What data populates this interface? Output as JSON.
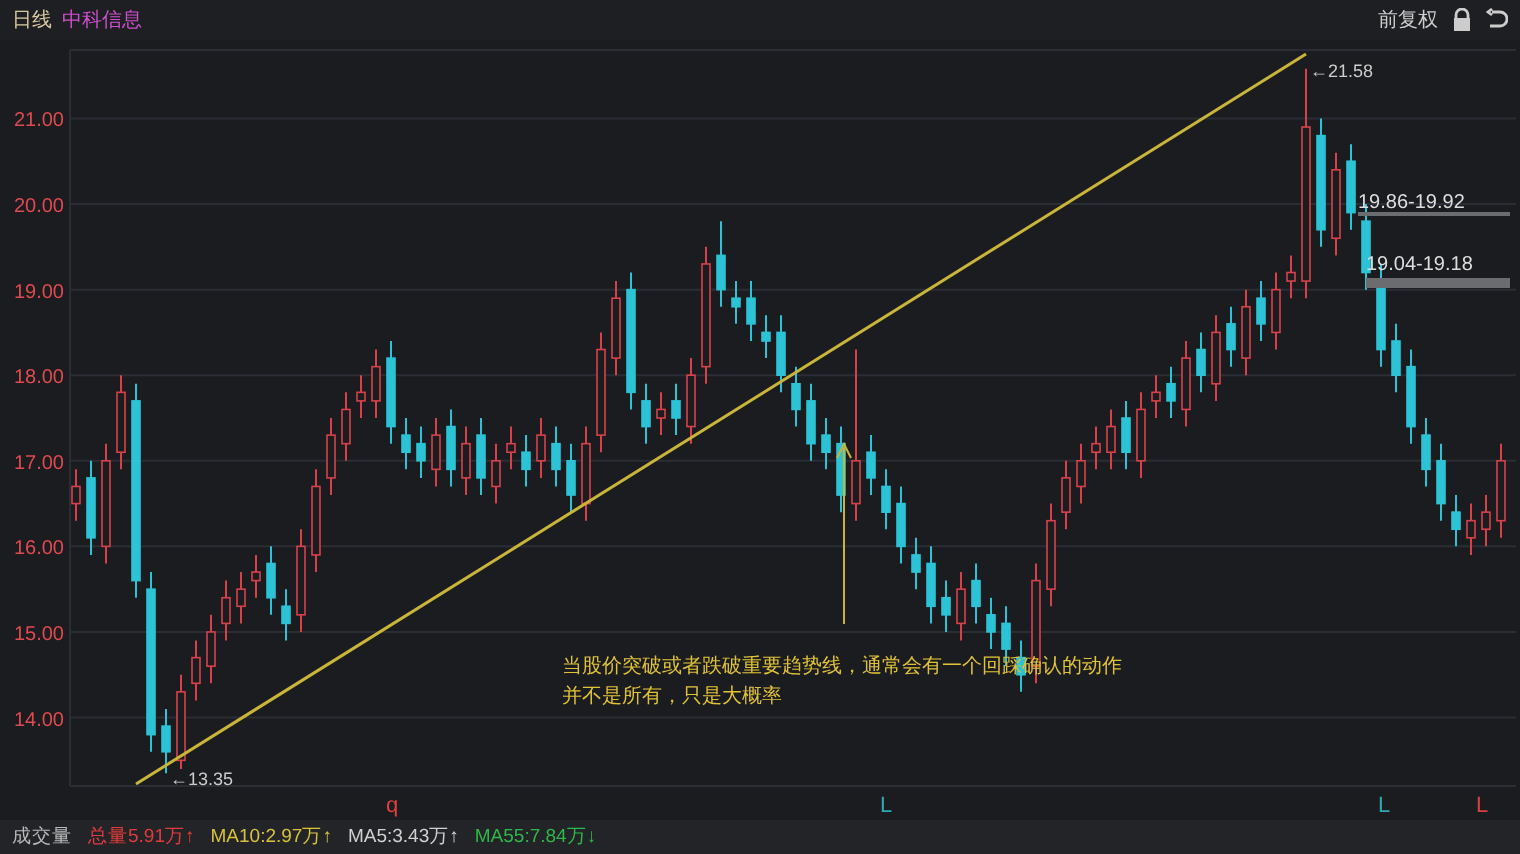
{
  "header": {
    "period": "日线",
    "name": "中科信息",
    "adjust": "前复权"
  },
  "chart_data": {
    "type": "candlestick",
    "ylim": [
      13.2,
      21.8
    ],
    "grid": true,
    "yticks": [
      {
        "value": 21,
        "label": "21.00"
      },
      {
        "value": 20,
        "label": "20.00"
      },
      {
        "value": 19,
        "label": "19.00"
      },
      {
        "value": 18,
        "label": "18.00"
      },
      {
        "value": 17,
        "label": "17.00"
      },
      {
        "value": 16,
        "label": "16.00"
      },
      {
        "value": 15,
        "label": "15.00"
      },
      {
        "value": 14,
        "label": "14.00"
      }
    ],
    "ohlc": [
      [
        16.5,
        16.9,
        16.3,
        16.7
      ],
      [
        16.8,
        17.0,
        15.9,
        16.1
      ],
      [
        16.0,
        17.2,
        15.8,
        17.0
      ],
      [
        17.1,
        18.0,
        16.9,
        17.8
      ],
      [
        17.7,
        17.9,
        15.4,
        15.6
      ],
      [
        15.5,
        15.7,
        13.6,
        13.8
      ],
      [
        13.9,
        14.1,
        13.35,
        13.6
      ],
      [
        13.5,
        14.5,
        13.4,
        14.3
      ],
      [
        14.4,
        14.9,
        14.2,
        14.7
      ],
      [
        14.6,
        15.2,
        14.4,
        15.0
      ],
      [
        15.1,
        15.6,
        14.9,
        15.4
      ],
      [
        15.3,
        15.7,
        15.1,
        15.5
      ],
      [
        15.6,
        15.9,
        15.4,
        15.7
      ],
      [
        15.8,
        16.0,
        15.2,
        15.4
      ],
      [
        15.3,
        15.5,
        14.9,
        15.1
      ],
      [
        15.2,
        16.2,
        15.0,
        16.0
      ],
      [
        15.9,
        16.9,
        15.7,
        16.7
      ],
      [
        16.8,
        17.5,
        16.6,
        17.3
      ],
      [
        17.2,
        17.8,
        17.0,
        17.6
      ],
      [
        17.7,
        18.0,
        17.5,
        17.8
      ],
      [
        17.7,
        18.3,
        17.5,
        18.1
      ],
      [
        18.2,
        18.4,
        17.2,
        17.4
      ],
      [
        17.3,
        17.5,
        16.9,
        17.1
      ],
      [
        17.2,
        17.4,
        16.8,
        17.0
      ],
      [
        16.9,
        17.5,
        16.7,
        17.3
      ],
      [
        17.4,
        17.6,
        16.7,
        16.9
      ],
      [
        16.8,
        17.4,
        16.6,
        17.2
      ],
      [
        17.3,
        17.5,
        16.6,
        16.8
      ],
      [
        16.7,
        17.2,
        16.5,
        17.0
      ],
      [
        17.1,
        17.4,
        16.9,
        17.2
      ],
      [
        17.1,
        17.3,
        16.7,
        16.9
      ],
      [
        17.0,
        17.5,
        16.8,
        17.3
      ],
      [
        17.2,
        17.4,
        16.7,
        16.9
      ],
      [
        17.0,
        17.2,
        16.4,
        16.6
      ],
      [
        16.5,
        17.4,
        16.3,
        17.2
      ],
      [
        17.3,
        18.5,
        17.1,
        18.3
      ],
      [
        18.2,
        19.1,
        18.0,
        18.9
      ],
      [
        19.0,
        19.2,
        17.6,
        17.8
      ],
      [
        17.7,
        17.9,
        17.2,
        17.4
      ],
      [
        17.5,
        17.8,
        17.3,
        17.6
      ],
      [
        17.7,
        17.9,
        17.3,
        17.5
      ],
      [
        17.4,
        18.2,
        17.2,
        18.0
      ],
      [
        18.1,
        19.5,
        17.9,
        19.3
      ],
      [
        19.4,
        19.8,
        18.8,
        19.0
      ],
      [
        18.9,
        19.1,
        18.6,
        18.8
      ],
      [
        18.9,
        19.1,
        18.4,
        18.6
      ],
      [
        18.5,
        18.7,
        18.2,
        18.4
      ],
      [
        18.5,
        18.7,
        17.8,
        18.0
      ],
      [
        17.9,
        18.1,
        17.4,
        17.6
      ],
      [
        17.7,
        17.9,
        17.0,
        17.2
      ],
      [
        17.3,
        17.5,
        16.9,
        17.1
      ],
      [
        17.2,
        17.4,
        16.4,
        16.6
      ],
      [
        16.5,
        18.3,
        16.3,
        17.0
      ],
      [
        17.1,
        17.3,
        16.6,
        16.8
      ],
      [
        16.7,
        16.9,
        16.2,
        16.4
      ],
      [
        16.5,
        16.7,
        15.8,
        16.0
      ],
      [
        15.9,
        16.1,
        15.5,
        15.7
      ],
      [
        15.8,
        16.0,
        15.1,
        15.3
      ],
      [
        15.4,
        15.6,
        15.0,
        15.2
      ],
      [
        15.1,
        15.7,
        14.9,
        15.5
      ],
      [
        15.6,
        15.8,
        15.1,
        15.3
      ],
      [
        15.2,
        15.4,
        14.8,
        15.0
      ],
      [
        15.1,
        15.3,
        14.6,
        14.8
      ],
      [
        14.7,
        14.9,
        14.3,
        14.5
      ],
      [
        14.6,
        15.8,
        14.4,
        15.6
      ],
      [
        15.5,
        16.5,
        15.3,
        16.3
      ],
      [
        16.4,
        17.0,
        16.2,
        16.8
      ],
      [
        16.7,
        17.2,
        16.5,
        17.0
      ],
      [
        17.1,
        17.4,
        16.9,
        17.2
      ],
      [
        17.1,
        17.6,
        16.9,
        17.4
      ],
      [
        17.5,
        17.7,
        16.9,
        17.1
      ],
      [
        17.0,
        17.8,
        16.8,
        17.6
      ],
      [
        17.7,
        18.0,
        17.5,
        17.8
      ],
      [
        17.9,
        18.1,
        17.5,
        17.7
      ],
      [
        17.6,
        18.4,
        17.4,
        18.2
      ],
      [
        18.3,
        18.5,
        17.8,
        18.0
      ],
      [
        17.9,
        18.7,
        17.7,
        18.5
      ],
      [
        18.6,
        18.8,
        18.1,
        18.3
      ],
      [
        18.2,
        19.0,
        18.0,
        18.8
      ],
      [
        18.9,
        19.1,
        18.4,
        18.6
      ],
      [
        18.5,
        19.2,
        18.3,
        19.0
      ],
      [
        19.1,
        19.4,
        18.9,
        19.2
      ],
      [
        19.1,
        21.58,
        18.9,
        20.9
      ],
      [
        20.8,
        21.0,
        19.5,
        19.7
      ],
      [
        19.6,
        20.6,
        19.4,
        20.4
      ],
      [
        20.5,
        20.7,
        19.7,
        19.9
      ],
      [
        19.8,
        20.0,
        19.0,
        19.2
      ],
      [
        19.1,
        19.3,
        18.1,
        18.3
      ],
      [
        18.4,
        18.6,
        17.8,
        18.0
      ],
      [
        18.1,
        18.3,
        17.2,
        17.4
      ],
      [
        17.3,
        17.5,
        16.7,
        16.9
      ],
      [
        17.0,
        17.2,
        16.3,
        16.5
      ],
      [
        16.4,
        16.6,
        16.0,
        16.2
      ],
      [
        16.1,
        16.5,
        15.9,
        16.3
      ],
      [
        16.2,
        16.6,
        16.0,
        16.4
      ],
      [
        16.3,
        17.2,
        16.1,
        17.0
      ]
    ]
  },
  "price_marks": [
    {
      "kind": "high",
      "text": "←21.58"
    },
    {
      "kind": "low",
      "text": "←13.35"
    }
  ],
  "zones": [
    {
      "text": "19.86-19.92"
    },
    {
      "text": "19.04-19.18"
    }
  ],
  "annotation": {
    "lines": [
      "当股价突破或者跌破重要趋势线，通常会有一个回踩确认的动作",
      "并不是所有，只是大概率"
    ]
  },
  "signals": [
    {
      "text": "q",
      "color": "#e0403f"
    },
    {
      "text": "L",
      "color": "#2fa8b5"
    },
    {
      "text": "L",
      "color": "#2fa8b5"
    },
    {
      "text": "L",
      "color": "#d84040"
    }
  ],
  "volume_bar": {
    "label": "成交量",
    "items": [
      {
        "text": "总量5.91万↑",
        "color": "#e03b3b"
      },
      {
        "text": "MA10:2.97万↑",
        "color": "#d8c23a"
      },
      {
        "text": "MA5:3.43万↑",
        "color": "#d0d0d0"
      },
      {
        "text": "MA55:7.84万↓",
        "color": "#2fb84a"
      }
    ]
  }
}
